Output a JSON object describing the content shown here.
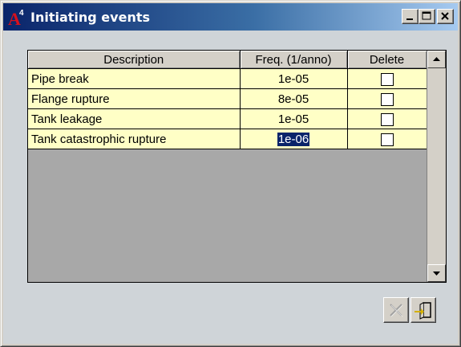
{
  "window": {
    "title": "Initiating events",
    "logo_letter": "A",
    "logo_superscript": "4",
    "controls": {
      "minimize": "minimize-icon",
      "maximize": "maximize-icon",
      "close": "close-icon"
    }
  },
  "grid": {
    "columns": [
      "Description",
      "Freq. (1/anno)",
      "Delete"
    ],
    "rows": [
      {
        "description": "Pipe break",
        "freq": "1e-05",
        "delete": false
      },
      {
        "description": "Flange rupture",
        "freq": "8e-05",
        "delete": false
      },
      {
        "description": "Tank leakage",
        "freq": "1e-05",
        "delete": false
      },
      {
        "description": "Tank catastrophic rupture",
        "freq": "1e-06",
        "delete": false,
        "freq_selected": true
      }
    ],
    "row_color": "#ffffc6",
    "empty_color": "#a8a8a8"
  },
  "actions": {
    "delete_icon": "x-icon",
    "delete_enabled": false,
    "exit_icon": "exit-door-icon"
  }
}
